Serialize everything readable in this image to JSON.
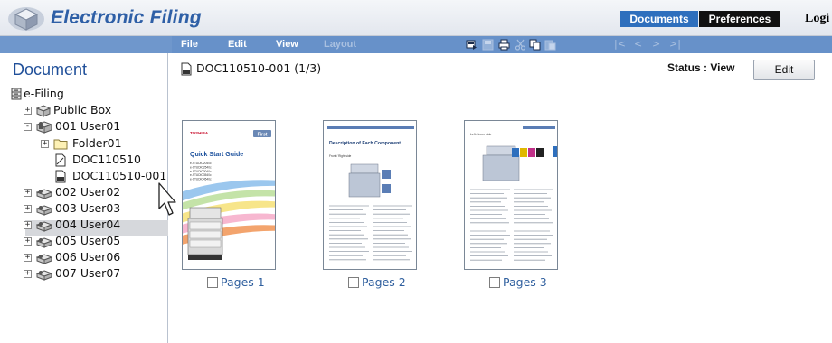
{
  "header": {
    "title": "Electronic Filing",
    "tabs": {
      "documents": "Documents",
      "preferences": "Preferences"
    },
    "login": "Logi"
  },
  "menubar": {
    "file": "File",
    "edit": "Edit",
    "view": "View",
    "layout": "Layout",
    "nav": [
      "|<",
      "<",
      ">",
      ">|"
    ]
  },
  "tree": {
    "title": "Document",
    "root": "e-Filing",
    "items": [
      {
        "label": "Public Box",
        "expander": "+"
      },
      {
        "label": "001 User01",
        "expander": "-"
      },
      {
        "label": "Folder01",
        "expander": "+"
      },
      {
        "label": "DOC110510"
      },
      {
        "label": "DOC110510-001",
        "selected": true
      },
      {
        "label": "002 User02",
        "expander": "+"
      },
      {
        "label": "003 User03",
        "expander": "+"
      },
      {
        "label": "004 User04",
        "expander": "+"
      },
      {
        "label": "005 User05",
        "expander": "+"
      },
      {
        "label": "006 User06",
        "expander": "+"
      },
      {
        "label": "007 User07",
        "expander": "+"
      }
    ]
  },
  "content": {
    "doc_title": "DOC110510-001  (1/3)",
    "status": "Status : View",
    "edit_button": "Edit",
    "pages": [
      {
        "label": "Pages 1",
        "thumbnail": {
          "brand": "TOSHIBA",
          "badge": "First",
          "heading": "Quick Start Guide",
          "models": [
            "e-STUDIO2040c",
            "e-STUDIO2540c",
            "e-STUDIO3040c",
            "e-STUDIO3540c",
            "e-STUDIO4540c"
          ]
        }
      },
      {
        "label": "Pages 2",
        "thumbnail": {
          "heading": "Description of Each Component",
          "subheading": "Front / Right side"
        }
      },
      {
        "label": "Pages 3",
        "thumbnail": {
          "heading": "Left / Inner side"
        }
      }
    ]
  },
  "colors": {
    "accent": "#2e5fa6",
    "menubar": "#6791c9",
    "documents_tab": "#2e6fbd",
    "preferences_tab": "#111111"
  }
}
